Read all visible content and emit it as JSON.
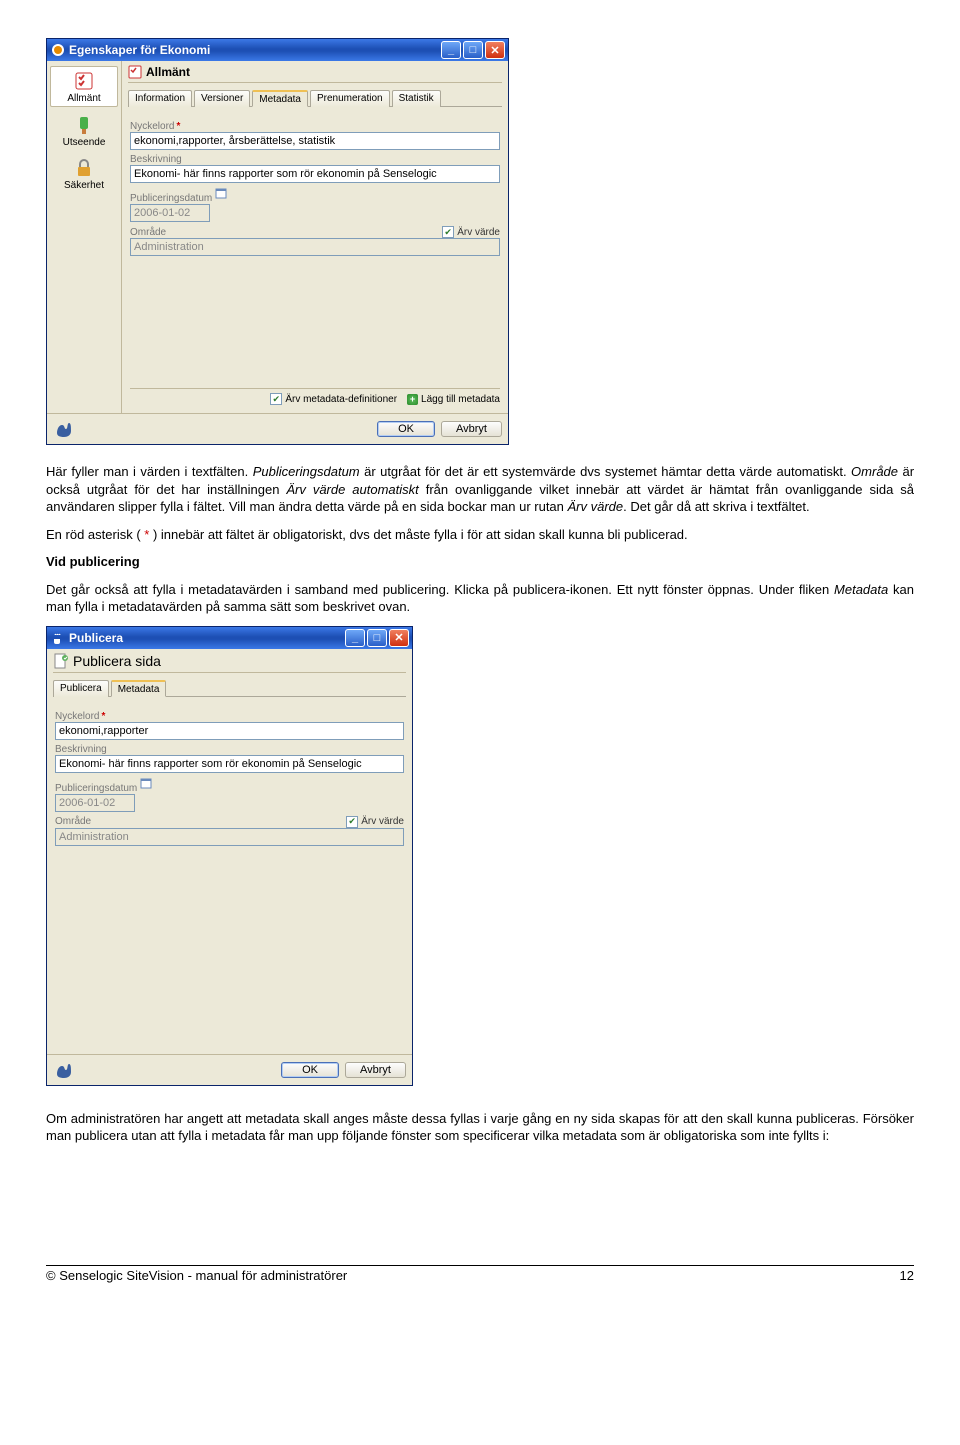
{
  "win1": {
    "title": "Egenskaper för Ekonomi",
    "panel_title": "Allmänt",
    "sidenav": [
      {
        "label": "Allmänt"
      },
      {
        "label": "Utseende"
      },
      {
        "label": "Säkerhet"
      }
    ],
    "tabs": [
      "Information",
      "Versioner",
      "Metadata",
      "Prenumeration",
      "Statistik"
    ],
    "active_tab": "Metadata",
    "fields": {
      "nyckelord_label": "Nyckelord",
      "nyckelord_value": "ekonomi,rapporter, årsberättelse, statistik",
      "beskrivning_label": "Beskrivning",
      "beskrivning_value": "Ekonomi- här finns rapporter som rör ekonomin på Senselogic",
      "pubdatum_label": "Publiceringsdatum",
      "pubdatum_value": "2006-01-02",
      "omrade_label": "Område",
      "omrade_value": "Administration",
      "arv_varde": "Ärv värde"
    },
    "footer_opts": {
      "arv_meta": "Ärv metadata-definitioner",
      "add_meta": "Lägg till metadata"
    },
    "buttons": {
      "ok": "OK",
      "cancel": "Avbryt"
    }
  },
  "win2": {
    "title": "Publicera",
    "panel_title": "Publicera sida",
    "tabs": [
      "Publicera",
      "Metadata"
    ],
    "active_tab": "Metadata",
    "fields": {
      "nyckelord_label": "Nyckelord",
      "nyckelord_value": "ekonomi,rapporter",
      "beskrivning_label": "Beskrivning",
      "beskrivning_value": "Ekonomi- här finns rapporter som rör ekonomin på Senselogic",
      "pubdatum_label": "Publiceringsdatum",
      "pubdatum_value": "2006-01-02",
      "omrade_label": "Område",
      "omrade_value": "Administration",
      "arv_varde": "Ärv värde"
    },
    "buttons": {
      "ok": "OK",
      "cancel": "Avbryt"
    }
  },
  "doc": {
    "p1a": "Här fyller man i värden i textfälten. ",
    "p1b": "Publiceringsdatum",
    "p1c": " är utgråat för det är ett systemvärde dvs systemet hämtar detta värde automatiskt. ",
    "p1d": "Område",
    "p1e": " är också utgråat för det har inställningen ",
    "p1f": "Ärv värde automatiskt",
    "p1g": " från ovanliggande vilket innebär att värdet är hämtat från ovanliggande sida så användaren slipper fylla i fältet. Vill man ändra detta värde på en sida bockar man ur rutan ",
    "p1h": "Ärv värde",
    "p1i": ". Det går då att skriva i textfältet.",
    "p2a": "En röd asterisk ( ",
    "p2b": "*",
    "p2c": " ) innebär att fältet är obligatoriskt, dvs det måste fylla i för att sidan skall kunna bli publicerad.",
    "p3": "Vid publicering",
    "p4a": "Det går också att fylla i metadatavärden i samband med publicering. Klicka på publicera-ikonen. Ett nytt fönster öppnas. Under fliken ",
    "p4b": "Metadata",
    "p4c": " kan man fylla i metadatavärden på samma sätt som beskrivet ovan.",
    "p5": "Om administratören har angett att metadata skall anges måste dessa fyllas i varje gång en ny sida skapas för att den skall kunna publiceras. Försöker man publicera utan att fylla i metadata får man upp följande fönster som specificerar vilka metadata som är obligatoriska som inte fyllts i:"
  },
  "footer": {
    "left": "© Senselogic SiteVision - manual för administratörer",
    "right": "12"
  }
}
